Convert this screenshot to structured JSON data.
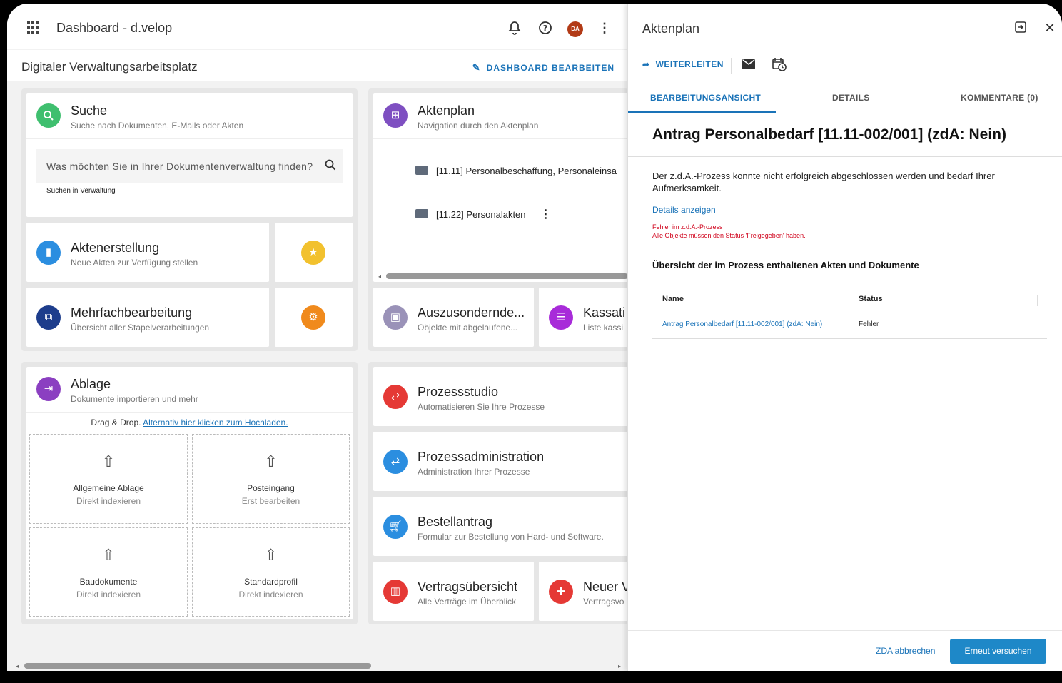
{
  "topbar": {
    "title": "Dashboard - d.velop",
    "avatar": "DA"
  },
  "subbar": {
    "title": "Digitaler Verwaltungsarbeitsplatz",
    "edit": "DASHBOARD BEARBEITEN"
  },
  "suche": {
    "title": "Suche",
    "sub": "Suche nach Dokumenten, E-Mails oder Akten",
    "placeholder": "Was möchten Sie in Ihrer Dokumentenverwaltung finden?",
    "help": "Suchen in Verwaltung"
  },
  "aktenerstellung": {
    "title": "Aktenerstellung",
    "sub": "Neue Akten zur Verfügung stellen"
  },
  "mehrfach": {
    "title": "Mehrfachbearbeitung",
    "sub": "Übersicht aller Stapelverarbeitungen"
  },
  "aktenplan": {
    "title": "Aktenplan",
    "sub": "Navigation durch den Aktenplan",
    "folders": [
      "[11.11] Personalbeschaffung, Personaleinsa",
      "[11.22] Personalakten"
    ]
  },
  "auszu": {
    "title": "Auszusondernde...",
    "sub": "Objekte mit abgelaufene..."
  },
  "kassation": {
    "title": "Kassati",
    "sub": "Liste kassi"
  },
  "ablage": {
    "title": "Ablage",
    "sub": "Dokumente importieren und mehr",
    "drag": "Drag & Drop.",
    "link": "Alternativ hier klicken zum Hochladen.",
    "cells": [
      {
        "title": "Allgemeine Ablage",
        "sub": "Direkt indexieren"
      },
      {
        "title": "Posteingang",
        "sub": "Erst bearbeiten"
      },
      {
        "title": "Baudokumente",
        "sub": "Direkt indexieren"
      },
      {
        "title": "Standardprofil",
        "sub": "Direkt indexieren"
      }
    ]
  },
  "prozessstudio": {
    "title": "Prozessstudio",
    "sub": "Automatisieren Sie Ihre Prozesse"
  },
  "prozessadmin": {
    "title": "Prozessadministration",
    "sub": "Administration Ihrer Prozesse"
  },
  "bestell": {
    "title": "Bestellantrag",
    "sub": "Formular zur Bestellung von Hard- und Software."
  },
  "vertrag": {
    "title": "Vertragsübersicht",
    "sub": "Alle Verträge im Überblick"
  },
  "neuer": {
    "title": "Neuer V",
    "sub": "Vertragsvo"
  },
  "panel": {
    "title": "Aktenplan",
    "forward": "WEITERLEITEN",
    "tabs": [
      "BEARBEITUNGSANSICHT",
      "DETAILS",
      "KOMMENTARE (0)"
    ],
    "heading": "Antrag Personalbedarf [11.11-002/001] (zdA: Nein)",
    "message": "Der z.d.A.-Prozess konnte nicht erfolgreich abgeschlossen werden und bedarf Ihrer Aufmerksamkeit.",
    "details_link": "Details anzeigen",
    "error_line1": "Fehler im z.d.A.-Prozess",
    "error_line2": "Alle Objekte müssen den Status 'Freigegeben' haben.",
    "overview": "Übersicht der im Prozess enthaltenen Akten und Dokumente",
    "table": {
      "headers": [
        "Name",
        "Status"
      ],
      "rows": [
        {
          "name": "Antrag Personalbedarf [11.11-002/001] (zdA: Nein)",
          "status": "Fehler"
        }
      ]
    },
    "cancel": "ZDA abbrechen",
    "retry": "Erneut versuchen"
  },
  "colors": {
    "accent": "#1a73b8",
    "error": "#d0021b",
    "green": "#3fbf6f",
    "blue": "#2b8ee0",
    "navy": "#1d3d8c",
    "purple": "#7e4fc1",
    "yellow": "#f2c12e",
    "orange": "#f08a1c",
    "red": "#e53935",
    "magenta": "#a82bd9"
  }
}
